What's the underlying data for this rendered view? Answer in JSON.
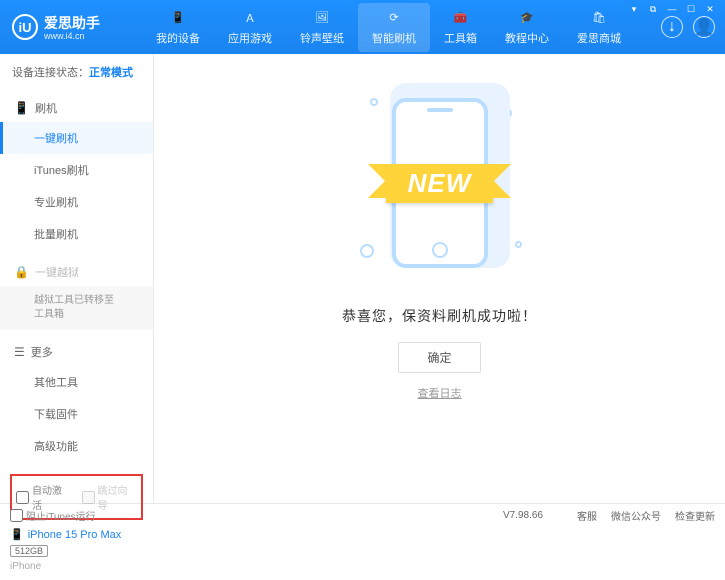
{
  "header": {
    "logo_letter": "iU",
    "app_name": "爱思助手",
    "app_url": "www.i4.cn",
    "nav": [
      {
        "label": "我的设备"
      },
      {
        "label": "应用游戏"
      },
      {
        "label": "铃声壁纸"
      },
      {
        "label": "智能刷机"
      },
      {
        "label": "工具箱"
      },
      {
        "label": "教程中心"
      },
      {
        "label": "爱思商城"
      }
    ]
  },
  "sidebar": {
    "conn_label": "设备连接状态：",
    "conn_mode": "正常模式",
    "section_flash": "刷机",
    "items_flash": [
      "一键刷机",
      "iTunes刷机",
      "专业刷机",
      "批量刷机"
    ],
    "section_jailbreak": "一键越狱",
    "jailbreak_note": "越狱工具已转移至\n工具箱",
    "section_more": "更多",
    "items_more": [
      "其他工具",
      "下载固件",
      "高级功能"
    ],
    "auto_activate": "自动激活",
    "skip_guide": "跳过向导",
    "device_name": "iPhone 15 Pro Max",
    "storage": "512GB",
    "device_type": "iPhone"
  },
  "content": {
    "ribbon": "NEW",
    "success_msg": "恭喜您，保资料刷机成功啦！",
    "ok_label": "确定",
    "log_label": "查看日志"
  },
  "footer": {
    "block_itunes": "阻止iTunes运行",
    "version": "V7.98.66",
    "links": [
      "客服",
      "微信公众号",
      "检查更新"
    ]
  }
}
